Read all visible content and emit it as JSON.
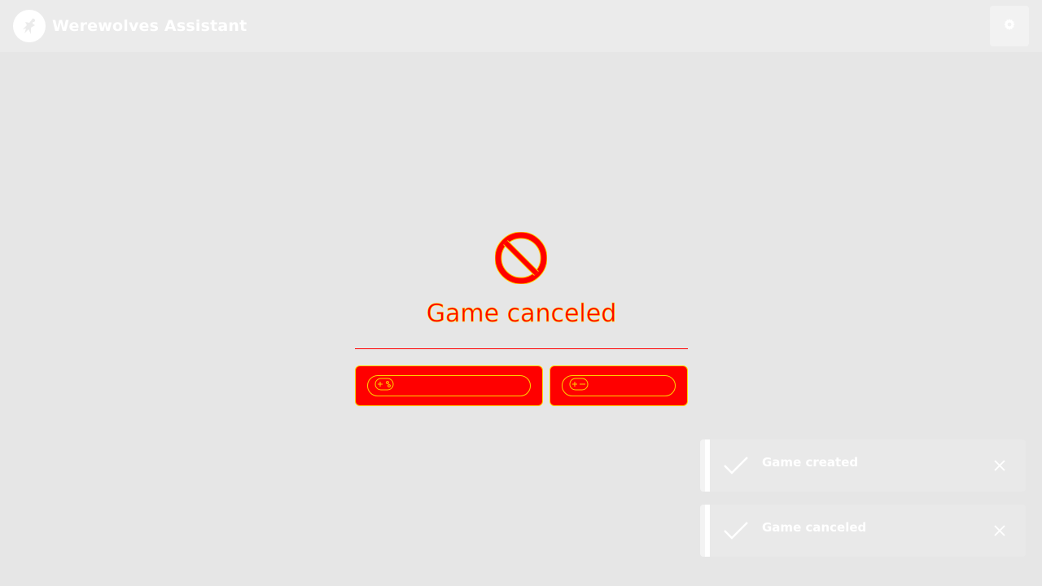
{
  "app": {
    "title": "Werewolves Assistant",
    "logo_icon": "werewolf-logo-icon"
  },
  "navbar": {
    "settings_icon": "gear-icon"
  },
  "main": {
    "status_icon": "ban-icon",
    "heading": "Game canceled",
    "buttons": [
      {
        "icon": "gamepad-icon",
        "label": ""
      },
      {
        "icon": "gamepad-icon",
        "label": ""
      }
    ]
  },
  "toasts": [
    {
      "message": "Game created",
      "icon": "check-icon",
      "close_icon": "close-icon"
    },
    {
      "message": "Game canceled",
      "icon": "check-icon",
      "close_icon": "close-icon"
    }
  ],
  "colors": {
    "background": "#e6e6e6",
    "accent": "#ff0000",
    "outline": "#ffd400",
    "text_light": "#ffffff"
  }
}
